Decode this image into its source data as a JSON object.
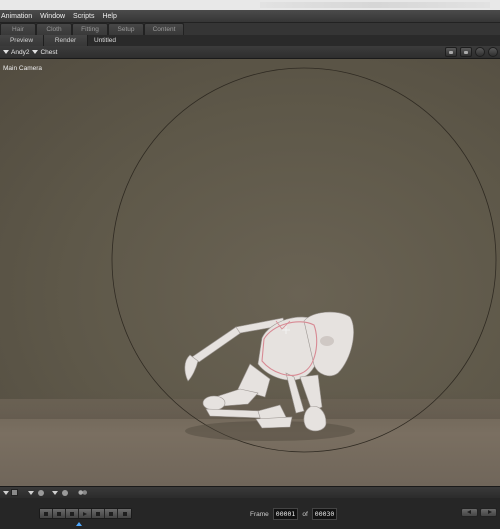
{
  "menubar": {
    "items": [
      "Animation",
      "Window",
      "Scripts",
      "Help"
    ]
  },
  "room_tabs": [
    "Hair",
    "Cloth",
    "Fitting",
    "Setup",
    "Content"
  ],
  "view_tabs": {
    "preview": "Preview",
    "render": "Render",
    "document_title": "Untitled"
  },
  "toolbar": {
    "figure_menu": "Andy2",
    "actor_menu": "Chest"
  },
  "viewport": {
    "camera_label": "Main Camera"
  },
  "timeline": {
    "frame_label": "Frame",
    "current_frame": "00001",
    "of_label": "of",
    "total_frames": "00030"
  },
  "colors": {
    "background": "#5e5849",
    "floor": "#766b5d",
    "figure": "#e6e2df",
    "selection": "#d88a94",
    "playhead": "#4ea8ff"
  }
}
